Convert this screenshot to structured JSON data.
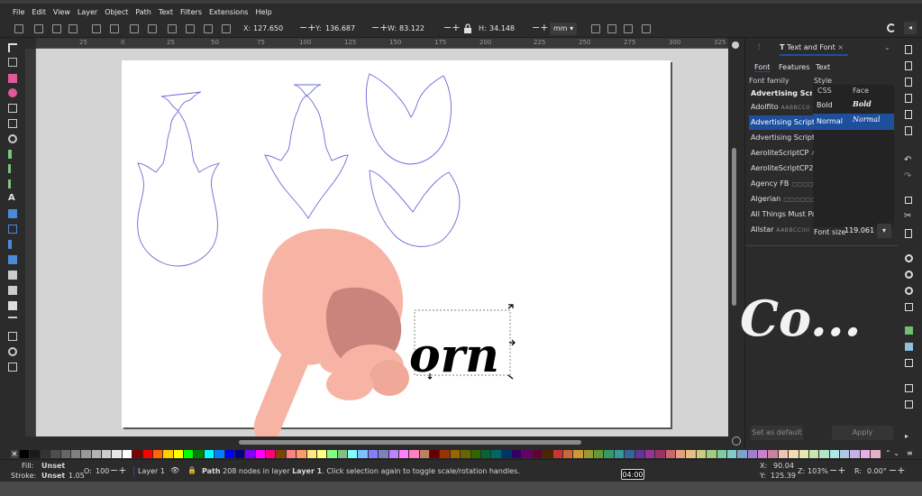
{
  "menu": [
    "File",
    "Edit",
    "View",
    "Layer",
    "Object",
    "Path",
    "Text",
    "Filters",
    "Extensions",
    "Help"
  ],
  "controls": {
    "x_label": "X:",
    "x_value": "127.650",
    "y_label": "Y:",
    "y_value": "136.687",
    "w_label": "W:",
    "w_value": "83.122",
    "h_label": "H:",
    "h_value": "34.148",
    "unit": "mm"
  },
  "ruler_h": [
    "25",
    "0",
    "25",
    "50",
    "75",
    "100",
    "125",
    "150",
    "175",
    "200",
    "225",
    "250",
    "275",
    "300",
    "325"
  ],
  "canvas_text": "orn",
  "dock": {
    "tab_label": "Text and Font",
    "close_glyph": "×",
    "subtabs": [
      "Font",
      "Features",
      "Text"
    ],
    "font_family_label": "Font family",
    "style_label": "Style",
    "current_family": "Advertising Script",
    "css_header": "CSS",
    "face_header": "Face",
    "styles": [
      {
        "css": "Bold",
        "face": "Bold"
      },
      {
        "css": "Normal",
        "face": "Normal"
      }
    ],
    "fonts": [
      {
        "name": "Adolfito",
        "preview": "AABBCCII"
      },
      {
        "name": "Advertising Script",
        "preview": ""
      },
      {
        "name": "Advertising Script M",
        "preview": ""
      },
      {
        "name": "AeroliteScriptCP",
        "preview": "A"
      },
      {
        "name": "AeroliteScriptCP2",
        "preview": ""
      },
      {
        "name": "Agency FB",
        "preview": "□□□□□□"
      },
      {
        "name": "Algerian",
        "preview": "□□□□□□□□"
      },
      {
        "name": "All Things Must Pass",
        "preview": ""
      },
      {
        "name": "Allstar",
        "preview": "AABBCCIIII"
      }
    ],
    "font_size_label": "Font size",
    "font_size_value": "119.061",
    "preview_text": "Co...",
    "set_default_label": "Set as default",
    "apply_label": "Apply"
  },
  "status": {
    "fill_label": "Fill:",
    "fill_value": "Unset",
    "stroke_label": "Stroke:",
    "stroke_value": "Unset",
    "stroke_width": "1.05",
    "opacity_label": "O:",
    "opacity_value": "100",
    "layer_label": "Layer 1",
    "message_strong": "Path",
    "message_rest": " 208 nodes in layer ",
    "message_layer": "Layer 1",
    "message_tail": ". Click selection again to toggle scale/rotation handles.",
    "x_label": "X:",
    "x_value": "90.04",
    "y_label": "Y:",
    "y_value": "125.39",
    "zoom_label": "Z:",
    "zoom_value": "103%",
    "rot_label": "R:",
    "rot_value": "0.00°"
  },
  "video_time": "04:00",
  "colors": {
    "accent": "#1e4f9c",
    "hand": "#f7b4a4",
    "hand_shadow": "#c9857b",
    "outline": "#6b6bd6"
  },
  "palette": [
    "#000000",
    "#1a1a1a",
    "#333333",
    "#4d4d4d",
    "#666666",
    "#808080",
    "#999999",
    "#b3b3b3",
    "#cccccc",
    "#e6e6e6",
    "#ffffff",
    "#800000",
    "#ff0000",
    "#ff6600",
    "#ffcc00",
    "#ffff00",
    "#00ff00",
    "#008000",
    "#00ffff",
    "#0080ff",
    "#0000ff",
    "#000080",
    "#8000ff",
    "#ff00ff",
    "#ff0080",
    "#804000",
    "#ff8080",
    "#ff9966",
    "#ffe680",
    "#ffff80",
    "#80ff80",
    "#80c080",
    "#80ffff",
    "#80c0ff",
    "#8080ff",
    "#8080c0",
    "#c080ff",
    "#ff80ff",
    "#ff80c0",
    "#c08060",
    "#660000",
    "#993300",
    "#996600",
    "#666600",
    "#336600",
    "#006633",
    "#006666",
    "#003366",
    "#330066",
    "#660066",
    "#660033",
    "#4d2600",
    "#cc3333",
    "#cc6633",
    "#cc9933",
    "#999933",
    "#669933",
    "#339966",
    "#339999",
    "#336699",
    "#663399",
    "#993399",
    "#993366",
    "#cc6666",
    "#e6a080",
    "#e6c080",
    "#cccc80",
    "#a0cc80",
    "#80cca0",
    "#80cccc",
    "#80a0cc",
    "#a080cc",
    "#cc80cc",
    "#cc80a0",
    "#f2c2b0",
    "#f2dcb0",
    "#e6e6b0",
    "#c8e6b0",
    "#b0e6c8",
    "#b0e6e6",
    "#b0c8e6",
    "#c8b0e6",
    "#e6b0e6",
    "#e6b0c8"
  ]
}
